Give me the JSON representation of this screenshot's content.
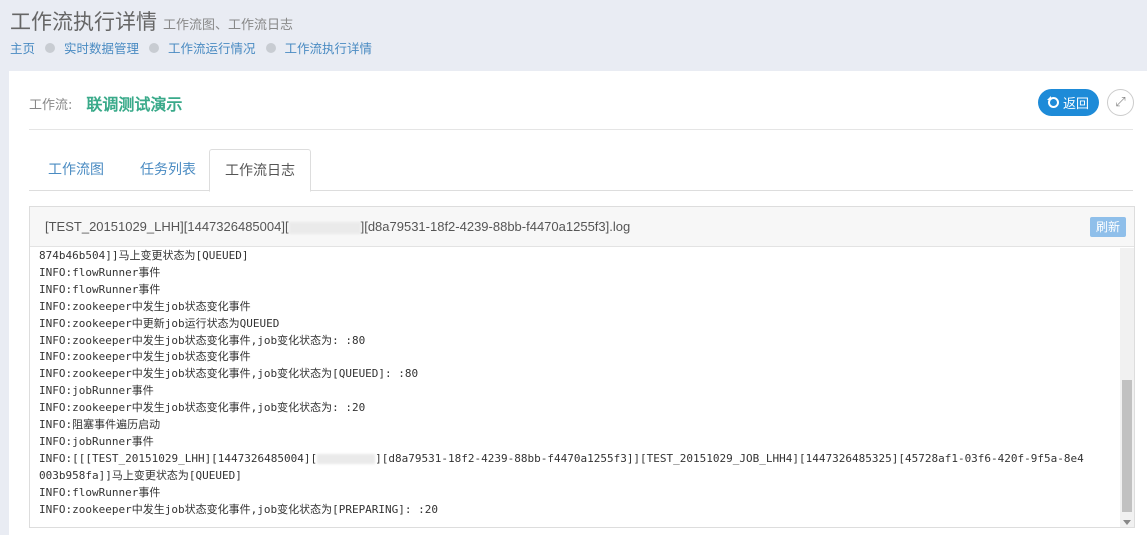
{
  "header": {
    "title": "工作流执行详情",
    "subtitle": "工作流图、工作流日志"
  },
  "breadcrumb": [
    "主页",
    "实时数据管理",
    "工作流运行情况",
    "工作流执行详情"
  ],
  "workflow": {
    "label": "工作流:",
    "name": "联调测试演示"
  },
  "actions": {
    "back_label": "返回",
    "expand_icon": "expand-icon"
  },
  "tabs": [
    {
      "label": "工作流图",
      "active": false
    },
    {
      "label": "任务列表",
      "active": false
    },
    {
      "label": "工作流日志",
      "active": true
    }
  ],
  "log": {
    "file_prefix": "[TEST_20151029_LHH][1447326485004][",
    "file_suffix": "][d8a79531-18f2-4239-88bb-f4470a1255f3].log",
    "refresh_label": "刷新",
    "lines": [
      "874b46b504]]马上变更状态为[QUEUED]",
      "INFO:flowRunner事件",
      "INFO:flowRunner事件",
      "INFO:zookeeper中发生job状态变化事件",
      "INFO:zookeeper中更新job运行状态为QUEUED",
      "INFO:zookeeper中发生job状态变化事件,job变化状态为: :80",
      "INFO:zookeeper中发生job状态变化事件",
      "INFO:zookeeper中发生job状态变化事件,job变化状态为[QUEUED]: :80",
      "INFO:jobRunner事件",
      "INFO:zookeeper中发生job状态变化事件,job变化状态为: :20",
      "INFO:阻塞事件遍历启动",
      "INFO:jobRunner事件",
      "INFO:[[[TEST_20151029_LHH][1447326485004][",
      "003b958fa]]马上变更状态为[QUEUED]",
      "INFO:flowRunner事件",
      "INFO:zookeeper中发生job状态变化事件,job变化状态为[PREPARING]: :20"
    ],
    "long_line_tail": "][d8a79531-18f2-4239-88bb-f4470a1255f3]][TEST_20151029_JOB_LHH4][1447326485325][45728af1-03f6-420f-9f5a-8e4"
  },
  "colors": {
    "accent": "#1e8bd8",
    "workflow_name": "#3aaa8a",
    "link": "#4a8bc2",
    "background": "#e9ecf3"
  }
}
